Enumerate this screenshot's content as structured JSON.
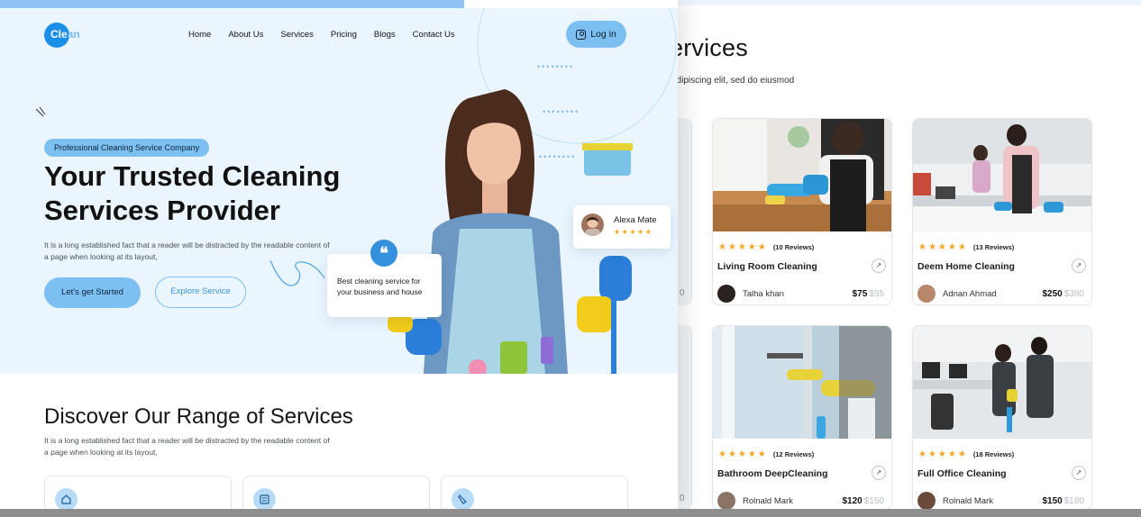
{
  "back_page": {
    "title": "ervices",
    "subtitle": "adipiscing elit, sed do eiusmod",
    "cards": [
      {
        "rating_stars": "★★★★★",
        "reviews": "(10 Reviews)",
        "name": "Living Room Cleaning",
        "provider": "Talha khan",
        "price": "$75",
        "old_price": "$95"
      },
      {
        "rating_stars": "★★★★★",
        "reviews": "(13 Reviews)",
        "name": "Deem Home Cleaning",
        "provider": "Adnan Ahmad",
        "price": "$250",
        "old_price": "$380"
      },
      {
        "rating_stars": "★★★★★",
        "reviews": "(12 Reviews)",
        "name": "Bathroom DeepCleaning",
        "provider": "Rolnald Mark",
        "price": "$120",
        "old_price": "$150"
      },
      {
        "rating_stars": "★★★★★",
        "reviews": "(18 Reviews)",
        "name": "Full Office Cleaning",
        "provider": "Rolnald Mark",
        "price": "$150",
        "old_price": "$180"
      }
    ],
    "edge_numbers": [
      "0",
      "0"
    ]
  },
  "header": {
    "logo_main": "Cle",
    "logo_accent": "an",
    "nav": [
      "Home",
      "About Us",
      "Services",
      "Pricing",
      "Blogs",
      "Contact Us"
    ],
    "login_label": "Log in"
  },
  "hero": {
    "badge": "Professional Cleaning Service Company",
    "title": "Your Trusted Cleaning Services Provider",
    "description": "It is a long established fact that a reader will be distracted by the readable content of a  page when looking at its layout,",
    "cta_primary": "Let's get Started",
    "cta_secondary": "Explore Service",
    "quote_mark": "❝",
    "quote_text": "Best cleaning service for your business and house",
    "reviewer_name": "Alexa Mate",
    "reviewer_stars": "★★★★★"
  },
  "discover": {
    "title": "Discover Our Range of Services",
    "description": "It is a long established fact that a reader will be distracted by the readable content of a  page when looking at its layout,"
  },
  "colors": {
    "accent": "#7cc0f2",
    "brand_blue": "#1b8fe8",
    "hero_bg": "#eaf5fe",
    "star": "#f6a623"
  }
}
